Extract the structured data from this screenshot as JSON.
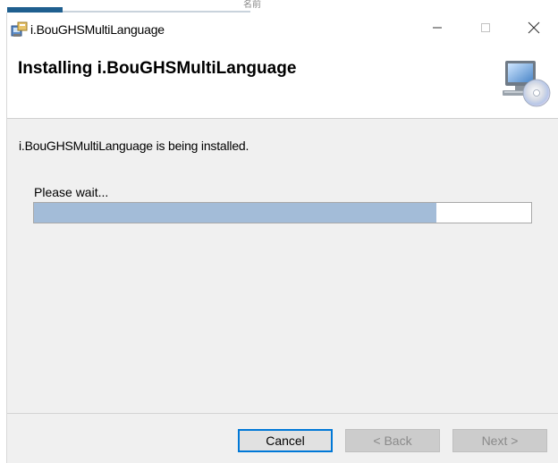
{
  "background": {
    "text": "名前"
  },
  "window": {
    "title": "i.BouGHSMultiLanguage",
    "controls": {
      "minimize": "minimize-icon",
      "maximize": "maximize-icon",
      "close": "close-icon"
    }
  },
  "header": {
    "title": "Installing i.BouGHSMultiLanguage",
    "icon": "computer-disc-icon"
  },
  "body": {
    "status": "i.BouGHSMultiLanguage is being installed.",
    "wait": "Please wait...",
    "progress": 0.81
  },
  "footer": {
    "cancel_label": "Cancel",
    "back_label": "< Back",
    "next_label": "Next >"
  },
  "colors": {
    "progress_fill": "#a3bcd8",
    "focus_border": "#0078d7",
    "dialog_bg": "#f0f0f0"
  }
}
